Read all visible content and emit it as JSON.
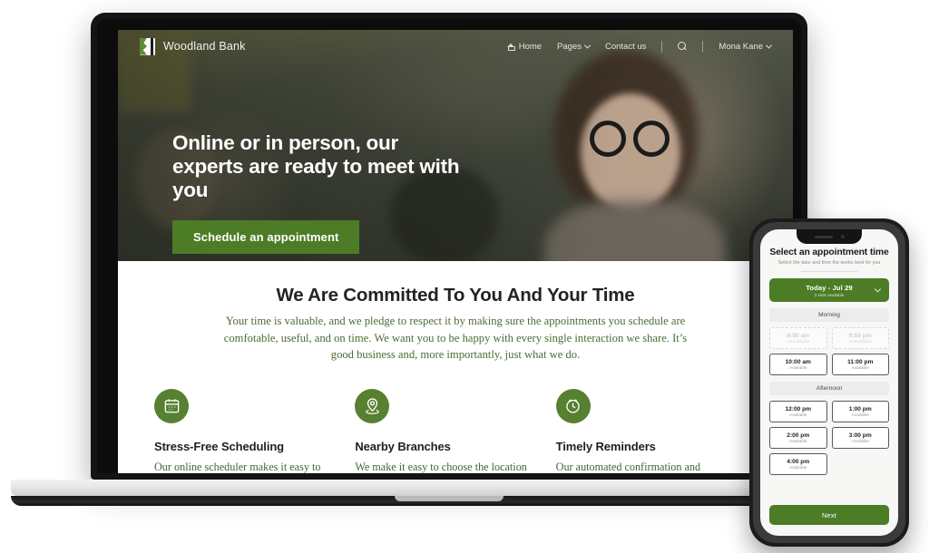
{
  "site": {
    "brand_name": "Woodland Bank",
    "nav": [
      {
        "label": "Home",
        "icon": "home-icon",
        "has_chevron": false
      },
      {
        "label": "Pages",
        "icon": "",
        "has_chevron": true
      },
      {
        "label": "Contact us",
        "icon": "",
        "has_chevron": false
      }
    ],
    "search_icon": "search-icon",
    "account": {
      "label": "Mona Kane",
      "has_chevron": true
    }
  },
  "hero": {
    "title": "Online or in person, our experts are ready to meet with you",
    "cta_label": "Schedule an appointment"
  },
  "committed": {
    "title": "We Are Committed To You And Your Time",
    "body": "Your time is valuable, and we pledge to respect it by making sure the appointments you schedule are comfotable, useful, and on time. We want you to be happy with every single interaction we share. It’s good business and, more importantly, just what we do."
  },
  "features": [
    {
      "icon": "calendar-icon",
      "title": "Stress-Free Scheduling",
      "body": "Our online scheduler makes it easy to get the meeting time"
    },
    {
      "icon": "location-pin-icon",
      "title": "Nearby Branches",
      "body": "We make it easy to choose the location to meet that is"
    },
    {
      "icon": "clock-icon",
      "title": "Timely Reminders",
      "body": "Our automated confirmation and reminder messages helps"
    }
  ],
  "phone": {
    "title": "Select an appointment time",
    "subtitle": "Select the date and time the works best for you",
    "date_selector": {
      "label": "Today - Jul 29",
      "sublabel": "3 slots available",
      "chevron_icon": "chevron-down-icon"
    },
    "sections": [
      {
        "heading": "Morning",
        "slots": [
          {
            "time": "8:00 am",
            "status": "Unavailable",
            "available": false
          },
          {
            "time": "9:00 pm",
            "status": "Unavailable",
            "available": false
          },
          {
            "time": "10:00 am",
            "status": "Available",
            "available": true
          },
          {
            "time": "11:00 pm",
            "status": "Available",
            "available": true
          }
        ]
      },
      {
        "heading": "Afternoon",
        "slots": [
          {
            "time": "12:00 pm",
            "status": "Available",
            "available": true
          },
          {
            "time": "1:00 pm",
            "status": "Available",
            "available": true
          },
          {
            "time": "2:00 pm",
            "status": "Available",
            "available": true
          },
          {
            "time": "3:00 pm",
            "status": "Available",
            "available": true
          },
          {
            "time": "4:00 pm",
            "status": "Available",
            "available": true
          }
        ]
      }
    ],
    "next_label": "Next"
  },
  "colors": {
    "brand_green": "#4d7c27",
    "icon_green": "#578030",
    "body_green": "#4c6b33",
    "heading_dark": "#232323"
  }
}
